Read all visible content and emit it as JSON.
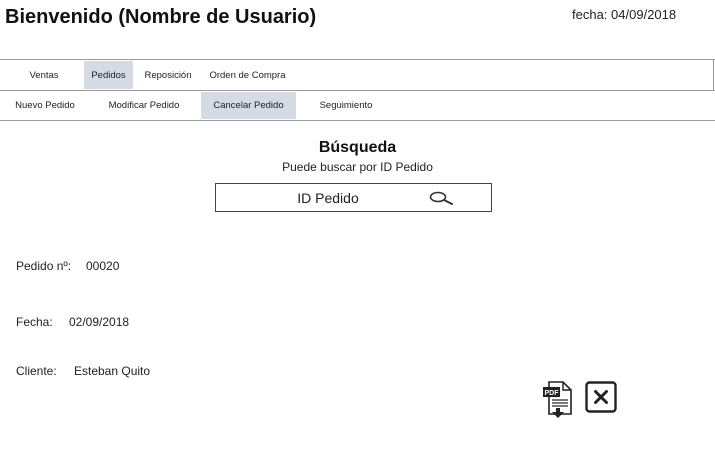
{
  "header": {
    "welcome": "Bienvenido (Nombre de Usuario)",
    "date_label": "fecha:",
    "date_value": "04/09/2018"
  },
  "main_nav": {
    "items": [
      {
        "label": "Ventas",
        "active": false
      },
      {
        "label": "Pedidos",
        "active": true
      },
      {
        "label": "Reposición",
        "active": false
      },
      {
        "label": "Orden de Compra",
        "active": false
      }
    ]
  },
  "sub_nav": {
    "items": [
      {
        "label": "Nuevo Pedido",
        "active": false
      },
      {
        "label": "Modificar Pedido",
        "active": false
      },
      {
        "label": "Cancelar Pedido",
        "active": true
      },
      {
        "label": "Seguimiento",
        "active": false
      }
    ]
  },
  "search": {
    "heading": "Búsqueda",
    "hint": "Puede buscar por ID Pedido",
    "placeholder": "ID Pedido",
    "icon": "search-icon"
  },
  "order": {
    "number_label": "Pedido nº:",
    "number_value": "00020",
    "date_label": "Fecha:",
    "date_value": "02/09/2018",
    "client_label": "Cliente:",
    "client_value": "Esteban Quito"
  },
  "actions": {
    "pdf_icon": "pdf-download-icon",
    "close_icon": "close-icon"
  },
  "colors": {
    "active_tab": "#d4dbe5",
    "divider": "#9a9a9a",
    "text": "#222222"
  }
}
